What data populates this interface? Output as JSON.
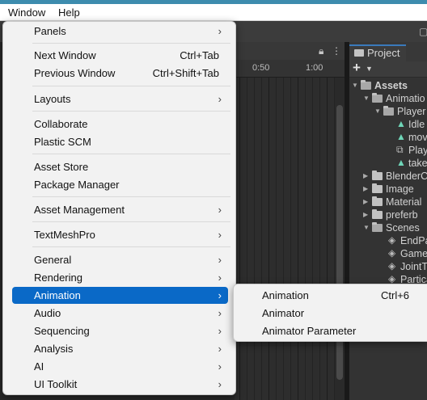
{
  "menubar": {
    "items": [
      {
        "label": "Window"
      },
      {
        "label": "Help"
      }
    ]
  },
  "timeline": {
    "ruler_labels": [
      "0:50",
      "1:00"
    ],
    "icons": {
      "lock": "lock-icon",
      "more": "more-options-icon"
    }
  },
  "project": {
    "tab_label": "Project",
    "tree": [
      {
        "label": "Assets",
        "depth": 0,
        "kind": "folder-open",
        "bold": true
      },
      {
        "label": "Animatio",
        "depth": 1,
        "kind": "folder-open"
      },
      {
        "label": "Player",
        "depth": 2,
        "kind": "folder-open"
      },
      {
        "label": "Idle",
        "depth": 3,
        "kind": "anim"
      },
      {
        "label": "mov",
        "depth": 3,
        "kind": "anim"
      },
      {
        "label": "Play",
        "depth": 3,
        "kind": "controller"
      },
      {
        "label": "take",
        "depth": 3,
        "kind": "anim"
      },
      {
        "label": "BlenderC",
        "depth": 1,
        "kind": "folder"
      },
      {
        "label": "Image",
        "depth": 1,
        "kind": "folder"
      },
      {
        "label": "Material",
        "depth": 1,
        "kind": "folder"
      },
      {
        "label": "preferb",
        "depth": 1,
        "kind": "folder"
      },
      {
        "label": "Scenes",
        "depth": 1,
        "kind": "folder-open"
      },
      {
        "label": "EndPa",
        "depth": 2,
        "kind": "scene"
      },
      {
        "label": "Game",
        "depth": 2,
        "kind": "scene"
      },
      {
        "label": "JointT",
        "depth": 2,
        "kind": "scene"
      },
      {
        "label": "Partica",
        "depth": 2,
        "kind": "scene"
      }
    ]
  },
  "window_menu": {
    "items": [
      {
        "label": "Panels",
        "shortcut": "",
        "submenu": true
      },
      {
        "label": "Next Window",
        "shortcut": "Ctrl+Tab",
        "submenu": false
      },
      {
        "label": "Previous Window",
        "shortcut": "Ctrl+Shift+Tab",
        "submenu": false
      },
      {
        "label": "Layouts",
        "shortcut": "",
        "submenu": true
      },
      {
        "label": "Collaborate",
        "shortcut": "",
        "submenu": false
      },
      {
        "label": "Plastic SCM",
        "shortcut": "",
        "submenu": false
      },
      {
        "label": "Asset Store",
        "shortcut": "",
        "submenu": false
      },
      {
        "label": "Package Manager",
        "shortcut": "",
        "submenu": false
      },
      {
        "label": "Asset Management",
        "shortcut": "",
        "submenu": true
      },
      {
        "label": "TextMeshPro",
        "shortcut": "",
        "submenu": true
      },
      {
        "label": "General",
        "shortcut": "",
        "submenu": true
      },
      {
        "label": "Rendering",
        "shortcut": "",
        "submenu": true
      },
      {
        "label": "Animation",
        "shortcut": "",
        "submenu": true,
        "highlighted": true
      },
      {
        "label": "Audio",
        "shortcut": "",
        "submenu": true
      },
      {
        "label": "Sequencing",
        "shortcut": "",
        "submenu": true
      },
      {
        "label": "Analysis",
        "shortcut": "",
        "submenu": true
      },
      {
        "label": "AI",
        "shortcut": "",
        "submenu": true
      },
      {
        "label": "UI Toolkit",
        "shortcut": "",
        "submenu": true
      }
    ]
  },
  "animation_submenu": {
    "items": [
      {
        "label": "Animation",
        "shortcut": "Ctrl+6"
      },
      {
        "label": "Animator",
        "shortcut": ""
      },
      {
        "label": "Animator Parameter",
        "shortcut": ""
      }
    ]
  },
  "colors": {
    "highlight": "#0a69c7",
    "accent_strip": "#3d8cae",
    "menu_bg": "#f2f2f2",
    "editor_bg": "#282828"
  }
}
